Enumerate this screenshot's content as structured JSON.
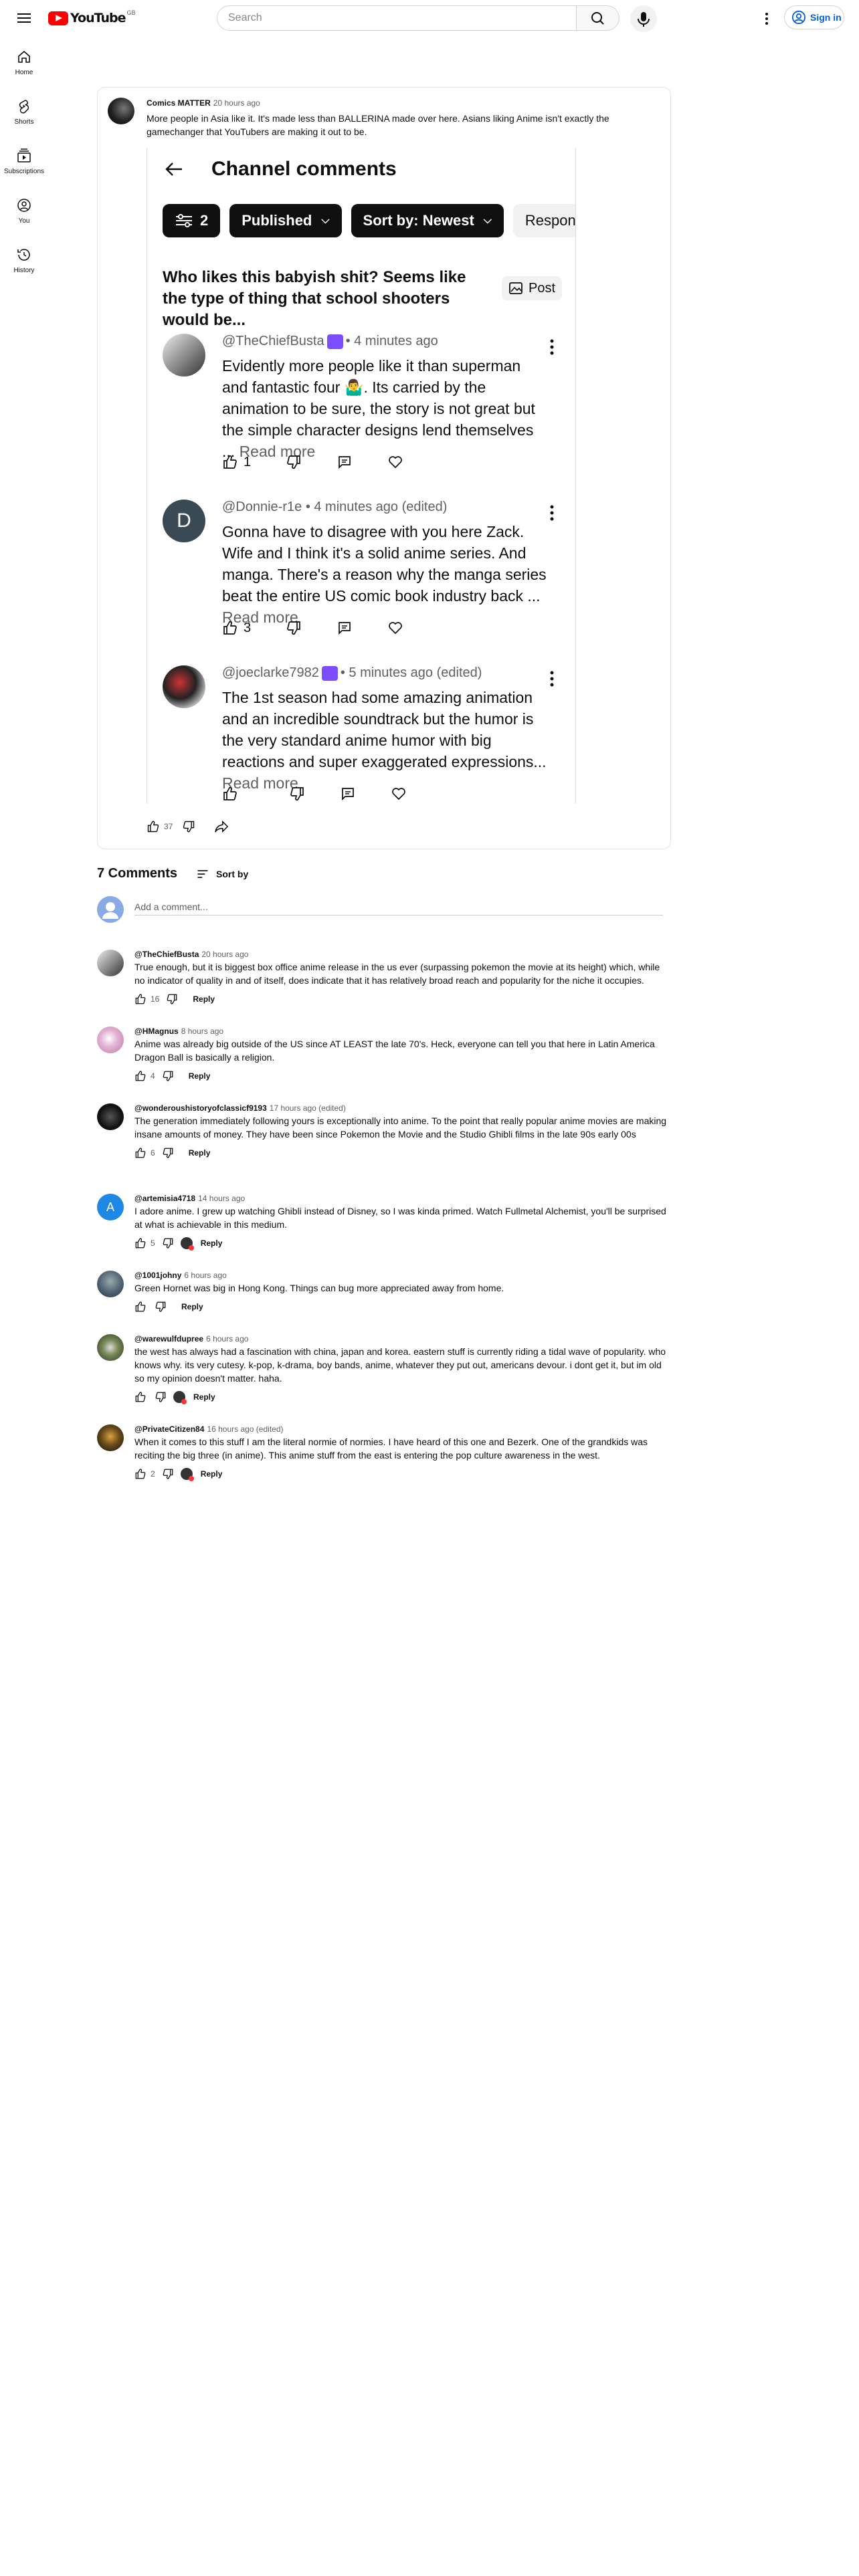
{
  "header": {
    "logo_text": "YouTube",
    "country_code": "GB",
    "search_placeholder": "Search",
    "signin_label": "Sign in"
  },
  "sidebar": {
    "items": [
      {
        "label": "Home"
      },
      {
        "label": "Shorts"
      },
      {
        "label": "Subscriptions"
      },
      {
        "label": "You"
      },
      {
        "label": "History"
      }
    ]
  },
  "post": {
    "author": "Comics MATTER",
    "time": "20 hours ago",
    "text": "More people in Asia like it. It's made less than BALLERINA made over here.  Asians liking Anime isn't exactly the gamechanger that YouTubers are making it out to be.",
    "likes": "37"
  },
  "embedded": {
    "title": "Channel comments",
    "filter_count": "2",
    "chip_published": "Published",
    "chip_sort": "Sort by: Newest",
    "chip_response": "Response",
    "post_text": "Who likes this babyish shit? Seems like the type of thing that school shooters would be...",
    "post_button": "Post",
    "replies": [
      {
        "handle": "@TheChiefBusta",
        "time": "• 4 minutes ago",
        "text": "Evidently more people like it than superman and fantastic four 🤷‍♂️. Its carried by the animation to be sure, the story is not great but the simple character designs lend themselves ...",
        "read_more": "Read more",
        "likes": "1",
        "avatar_letter": ""
      },
      {
        "handle": "@Donnie-r1e",
        "time": "• 4 minutes ago (edited)",
        "text": "Gonna have to disagree with you here Zack. Wife and I think it's a solid anime series. And manga. There's a reason why the manga series beat the entire US comic book industry back ...",
        "read_more": "Read more",
        "likes": "3",
        "avatar_letter": "D"
      },
      {
        "handle": "@joeclarke7982",
        "time": "• 5 minutes ago (edited)",
        "text": "The 1st season had some amazing animation and an incredible soundtrack but the humor is the very standard anime humor with big reactions and super exaggerated expressions...",
        "read_more": "Read more",
        "likes": "",
        "avatar_letter": ""
      }
    ]
  },
  "comments_section": {
    "count_label": "7 Comments",
    "sort_label": "Sort by",
    "add_placeholder": "Add a comment..."
  },
  "comments": [
    {
      "author": "@TheChiefBusta",
      "time": "20 hours ago",
      "text": "True enough, but it is biggest box office anime release in the us ever (surpassing pokemon the movie at its height) which, while no indicator of quality in and of itself, does indicate that it has relatively broad reach and popularity for the niche it occupies.",
      "likes": "16",
      "reply": "Reply",
      "hearted": false,
      "avatar_letter": "",
      "avatar_color": "#8a8a8a"
    },
    {
      "author": "@HMagnus",
      "time": "8 hours ago",
      "text": "Anime was already big outside of the US since AT LEAST the late 70's. Heck, everyone can tell you that here in Latin America Dragon Ball is basically a religion.",
      "likes": "4",
      "reply": "Reply",
      "hearted": false,
      "avatar_letter": "",
      "avatar_color": "#d9a0c8"
    },
    {
      "author": "@wonderoushistoryofclassicf9193",
      "time": "17 hours ago (edited)",
      "text": "The generation immediately following yours is exceptionally into anime. To the point that really popular anime movies are making insane amounts of money.  They have been since Pokemon the Movie and the Studio Ghibli films in the late 90s early 00s",
      "likes": "6",
      "reply": "Reply",
      "hearted": false,
      "avatar_letter": "",
      "avatar_color": "#222222"
    },
    {
      "author": "@artemisia4718",
      "time": "14 hours ago",
      "text": "I adore anime. I grew up watching Ghibli instead of Disney, so I was kinda primed. Watch Fullmetal Alchemist, you'll be surprised at what is achievable in this medium.",
      "likes": "5",
      "reply": "Reply",
      "hearted": true,
      "avatar_letter": "A",
      "avatar_color": "#1e88e5"
    },
    {
      "author": "@1001johny",
      "time": "6 hours ago",
      "text": "Green Hornet was big in Hong Kong. Things can bug more appreciated away from home.",
      "likes": "",
      "reply": "Reply",
      "hearted": false,
      "avatar_letter": "",
      "avatar_color": "#6b7480"
    },
    {
      "author": "@warewulfdupree",
      "time": "6 hours ago",
      "text": "the west has always had a fascination with china, japan and korea. eastern stuff is currently riding a tidal wave of popularity. who knows why. its very cutesy. k-pop, k-drama, boy bands, anime, whatever they put out, americans devour. i dont get it, but im old so my opinion doesn't matter. haha.",
      "likes": "",
      "reply": "Reply",
      "hearted": true,
      "avatar_letter": "",
      "avatar_color": "#4a5a3a"
    },
    {
      "author": "@PrivateCitizen84",
      "time": "16 hours ago (edited)",
      "text": "When it comes to this stuff I am the literal normie of normies. I have heard of this one and Bezerk. One of the grandkids was reciting the big three (in anime). This anime stuff from the east is entering the pop culture awareness in the west.",
      "likes": "2",
      "reply": "Reply",
      "hearted": true,
      "avatar_letter": "",
      "avatar_color": "#3a2e1a"
    }
  ]
}
